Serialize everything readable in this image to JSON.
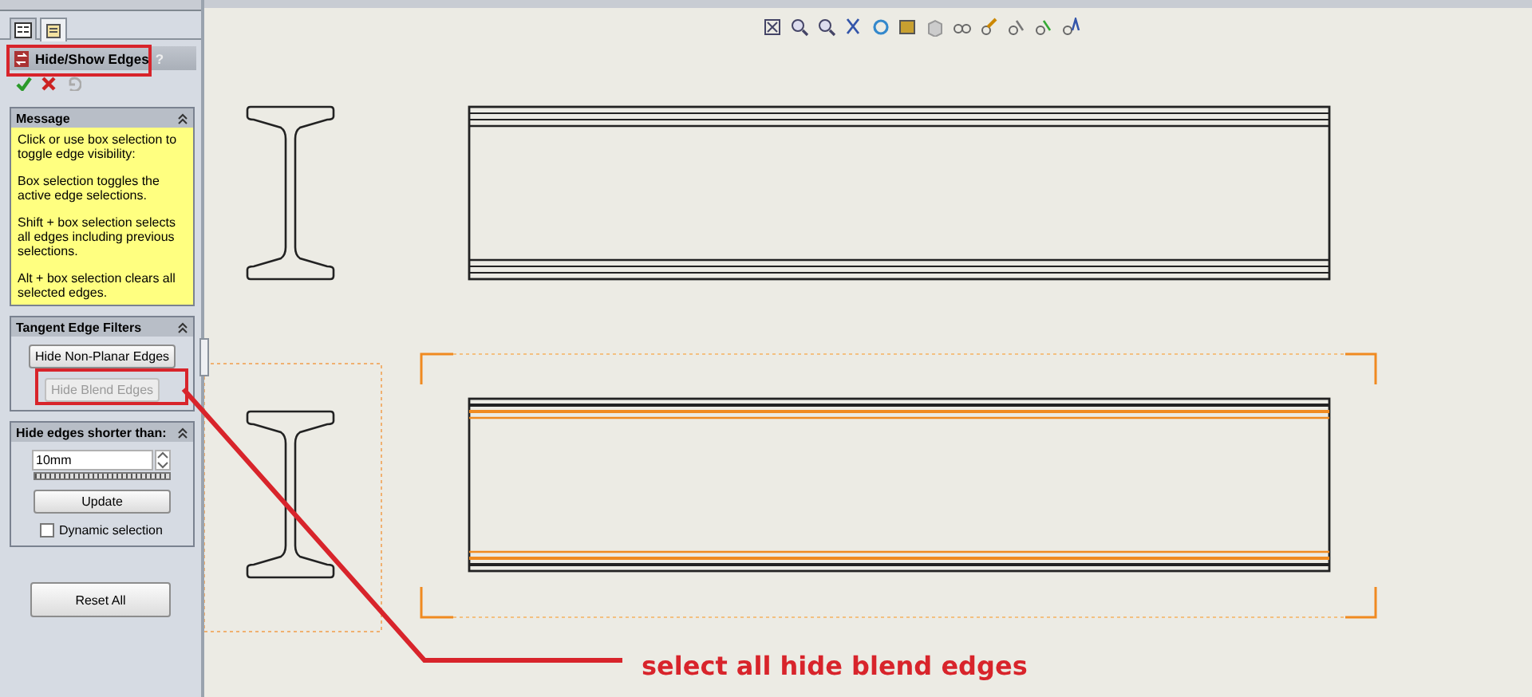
{
  "panel_tabs": [
    {
      "kind": "tree",
      "selected": false
    },
    {
      "kind": "properties",
      "selected": true
    }
  ],
  "property_manager": {
    "title": "Hide/Show Edges",
    "help": "?"
  },
  "message": {
    "title": "Message",
    "paragraphs": [
      "Click or use box selection to toggle edge visibility:",
      "Box selection toggles the active edge selections.",
      "Shift + box selection selects all edges including previous selections.",
      "Alt + box selection clears all selected edges."
    ]
  },
  "tangent_filters": {
    "title": "Tangent Edge Filters",
    "buttons": [
      {
        "label": "Hide Non-Planar Edges",
        "disabled": false
      },
      {
        "label": "Hide Blend Edges",
        "disabled": true
      }
    ]
  },
  "short_edges": {
    "title": "Hide edges shorter than:",
    "value": "10mm",
    "update": "Update",
    "dynamic_selection": {
      "label": "Dynamic selection",
      "checked": false
    }
  },
  "reset": "Reset All",
  "views": [
    {
      "selected": false
    },
    {
      "selected": true
    }
  ],
  "annotation": {
    "text": "select all hide blend edges"
  }
}
